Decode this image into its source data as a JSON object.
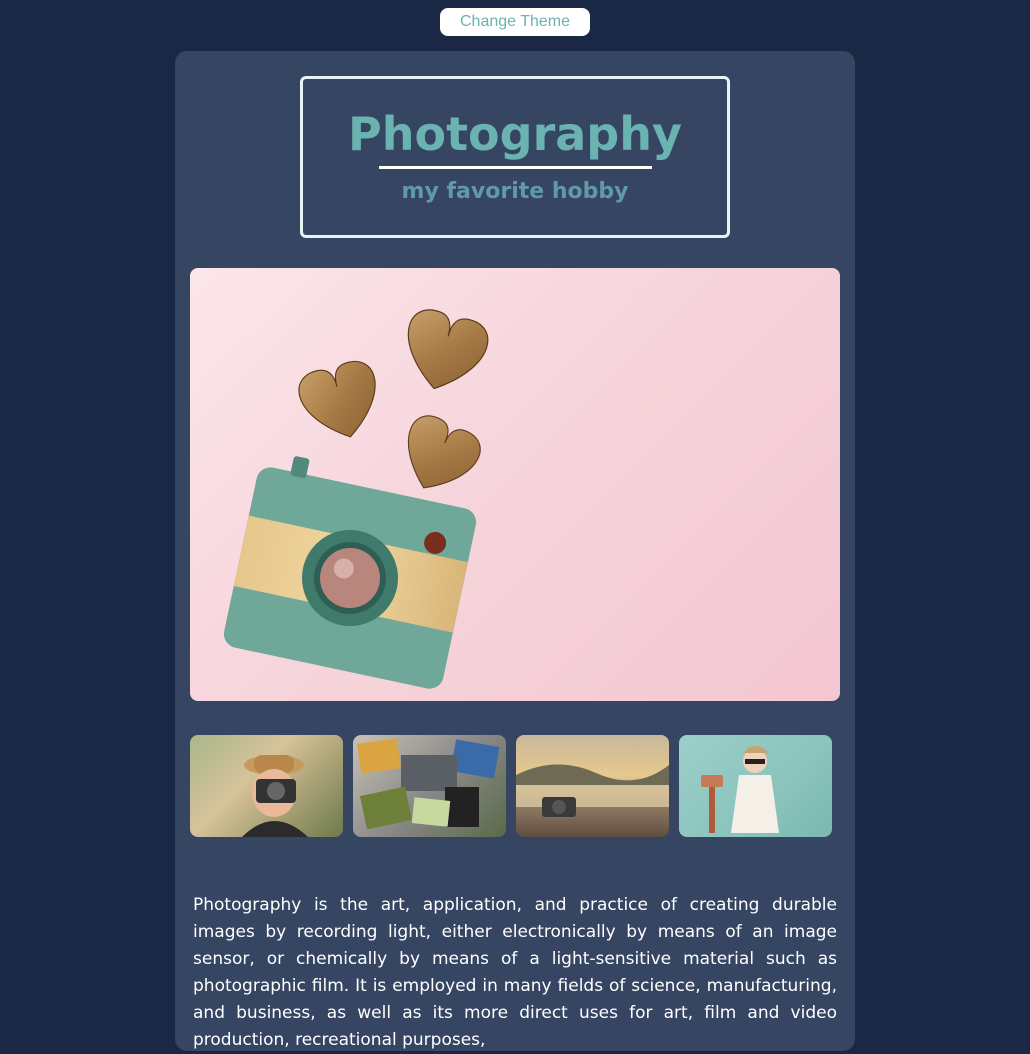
{
  "toolbar": {
    "theme_button_label": "Change Theme"
  },
  "header": {
    "title": "Photography",
    "subtitle": "my favorite hobby"
  },
  "hero_image": {
    "icon": "camera-with-hearts-image"
  },
  "gallery": {
    "thumbnails": [
      {
        "icon": "woman-with-camera-image"
      },
      {
        "icon": "photos-and-laptop-image"
      },
      {
        "icon": "camera-on-dock-image"
      },
      {
        "icon": "girl-with-camera-image"
      }
    ]
  },
  "description": "Photography is the art, application, and practice of creating durable images by recording light, either electronically by means of an image sensor, or chemically by means of a light-sensitive material such as photographic film. It is employed in many fields of science, manufacturing, and business, as well as its more direct uses for art, film and video production, recreational purposes,",
  "colors": {
    "page_background": "#1b2845",
    "card_background": "#354562",
    "accent": "#6bb3b0",
    "subtitle": "#5f9aa8"
  }
}
